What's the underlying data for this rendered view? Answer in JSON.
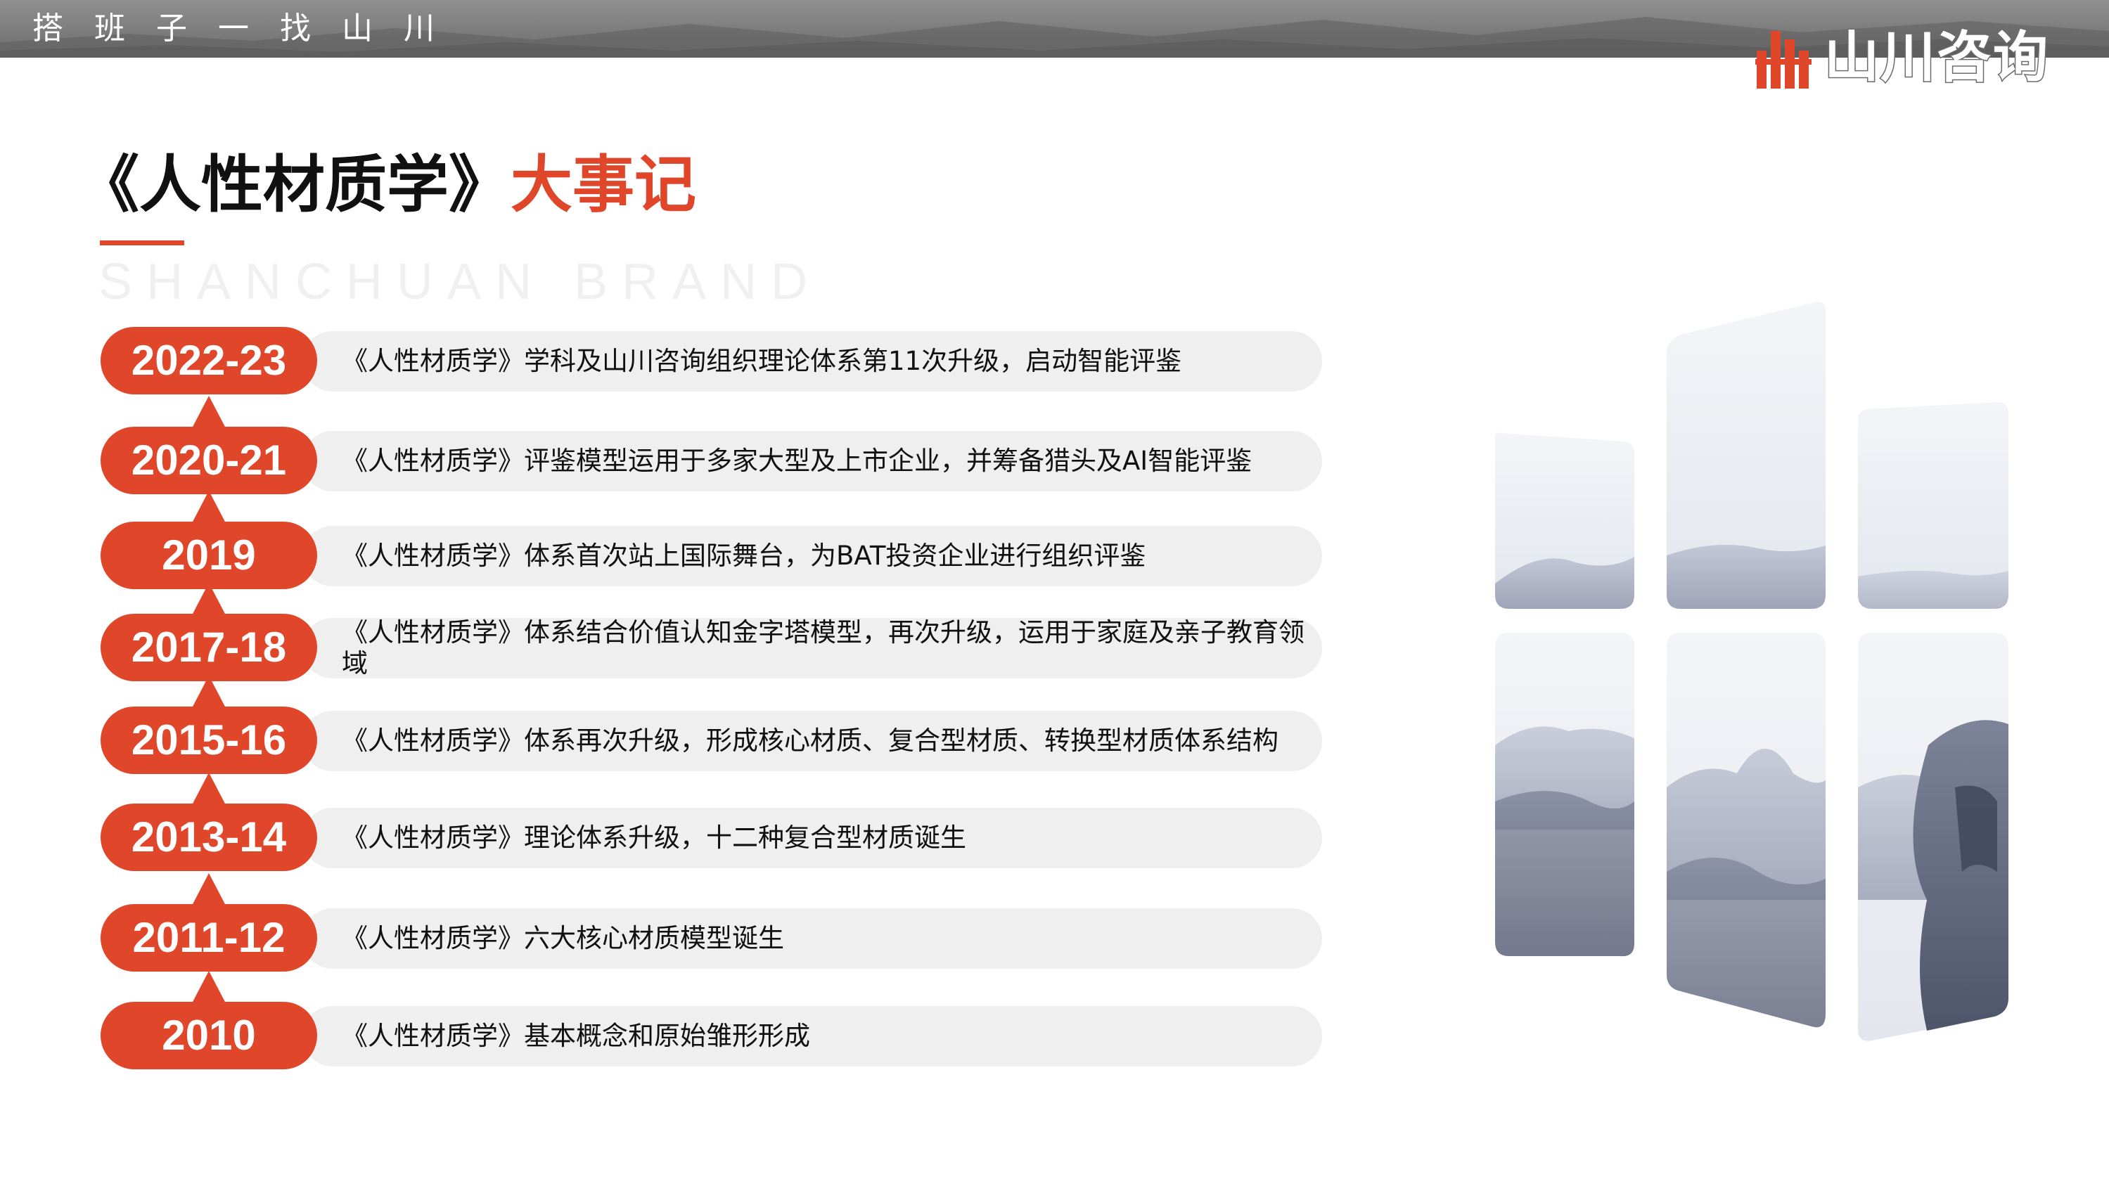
{
  "header": {
    "slogan": "搭班子一找山川",
    "logo_text": "山川咨询"
  },
  "title": {
    "main": "《人性材质学》",
    "accent": "大事记",
    "subtitle": "SHANCHUAN BRAND"
  },
  "timeline": [
    {
      "year": "2022-23",
      "text": "《人性材质学》学科及山川咨询组织理论体系第11次升级，启动智能评鉴"
    },
    {
      "year": "2020-21",
      "text": "《人性材质学》评鉴模型运用于多家大型及上市企业，并筹备猎头及AI智能评鉴"
    },
    {
      "year": "2019",
      "text": "《人性材质学》体系首次站上国际舞台，为BAT投资企业进行组织评鉴"
    },
    {
      "year": "2017-18",
      "text": "《人性材质学》体系结合价值认知金字塔模型，再次升级，运用于家庭及亲子教育领域"
    },
    {
      "year": "2015-16",
      "text": "《人性材质学》体系再次升级，形成核心材质、复合型材质、转换型材质体系结构"
    },
    {
      "year": "2013-14",
      "text": "《人性材质学》理论体系升级，十二种复合型材质诞生"
    },
    {
      "year": "2011-12",
      "text": "《人性材质学》六大核心材质模型诞生"
    },
    {
      "year": "2010",
      "text": "《人性材质学》基本概念和原始雏形形成"
    }
  ],
  "colors": {
    "accent": "#e0472a",
    "bar": "#efefef",
    "banner": "#7a7a7a"
  },
  "icons": {
    "logo": "bar-chart-logo-icon",
    "tiles": "ink-mountain-tiles-icon"
  }
}
